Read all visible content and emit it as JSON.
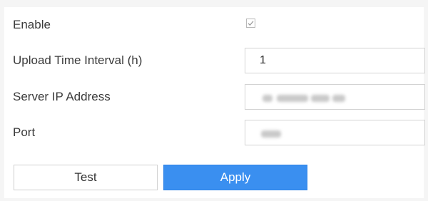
{
  "form": {
    "enable": {
      "label": "Enable",
      "checked": true
    },
    "upload_time_interval": {
      "label": "Upload Time Interval (h)",
      "value": "1"
    },
    "server_ip_address": {
      "label": "Server IP Address",
      "value": "",
      "obscured": true
    },
    "port": {
      "label": "Port",
      "value": "",
      "obscured": true
    }
  },
  "buttons": {
    "test_label": "Test",
    "apply_label": "Apply"
  },
  "colors": {
    "apply_background": "#3a8ff0",
    "panel_background": "#ffffff",
    "page_background": "#f5f5f5"
  },
  "icons": {
    "enable_checkbox": "checkmark-icon"
  }
}
